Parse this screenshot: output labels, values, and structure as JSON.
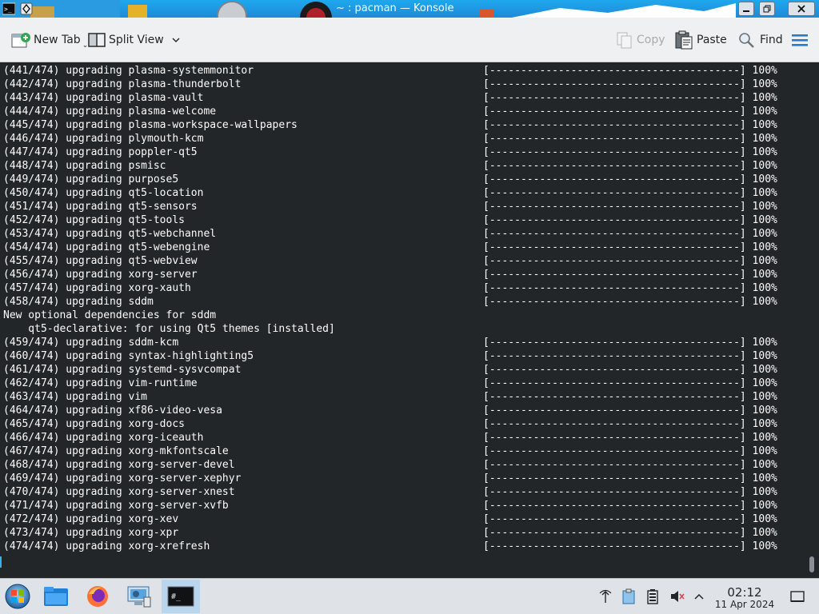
{
  "window": {
    "title": "~ : pacman — Konsole"
  },
  "toolbar": {
    "new_tab": "New Tab",
    "split_view": "Split View",
    "copy": "Copy",
    "paste": "Paste",
    "find": "Find"
  },
  "terminal": {
    "lines": [
      {
        "text": "(441/474) upgrading plasma-systemmonitor",
        "progress": "[----------------------------------------] 100%"
      },
      {
        "text": "(442/474) upgrading plasma-thunderbolt",
        "progress": "[----------------------------------------] 100%"
      },
      {
        "text": "(443/474) upgrading plasma-vault",
        "progress": "[----------------------------------------] 100%"
      },
      {
        "text": "(444/474) upgrading plasma-welcome",
        "progress": "[----------------------------------------] 100%"
      },
      {
        "text": "(445/474) upgrading plasma-workspace-wallpapers",
        "progress": "[----------------------------------------] 100%"
      },
      {
        "text": "(446/474) upgrading plymouth-kcm",
        "progress": "[----------------------------------------] 100%"
      },
      {
        "text": "(447/474) upgrading poppler-qt5",
        "progress": "[----------------------------------------] 100%"
      },
      {
        "text": "(448/474) upgrading psmisc",
        "progress": "[----------------------------------------] 100%"
      },
      {
        "text": "(449/474) upgrading purpose5",
        "progress": "[----------------------------------------] 100%"
      },
      {
        "text": "(450/474) upgrading qt5-location",
        "progress": "[----------------------------------------] 100%"
      },
      {
        "text": "(451/474) upgrading qt5-sensors",
        "progress": "[----------------------------------------] 100%"
      },
      {
        "text": "(452/474) upgrading qt5-tools",
        "progress": "[----------------------------------------] 100%"
      },
      {
        "text": "(453/474) upgrading qt5-webchannel",
        "progress": "[----------------------------------------] 100%"
      },
      {
        "text": "(454/474) upgrading qt5-webengine",
        "progress": "[----------------------------------------] 100%"
      },
      {
        "text": "(455/474) upgrading qt5-webview",
        "progress": "[----------------------------------------] 100%"
      },
      {
        "text": "(456/474) upgrading xorg-server",
        "progress": "[----------------------------------------] 100%"
      },
      {
        "text": "(457/474) upgrading xorg-xauth",
        "progress": "[----------------------------------------] 100%"
      },
      {
        "text": "(458/474) upgrading sddm",
        "progress": "[----------------------------------------] 100%"
      },
      {
        "text": "New optional dependencies for sddm",
        "progress": ""
      },
      {
        "text": "    qt5-declarative: for using Qt5 themes [installed]",
        "progress": ""
      },
      {
        "text": "(459/474) upgrading sddm-kcm",
        "progress": "[----------------------------------------] 100%"
      },
      {
        "text": "(460/474) upgrading syntax-highlighting5",
        "progress": "[----------------------------------------] 100%"
      },
      {
        "text": "(461/474) upgrading systemd-sysvcompat",
        "progress": "[----------------------------------------] 100%"
      },
      {
        "text": "(462/474) upgrading vim-runtime",
        "progress": "[----------------------------------------] 100%"
      },
      {
        "text": "(463/474) upgrading vim",
        "progress": "[----------------------------------------] 100%"
      },
      {
        "text": "(464/474) upgrading xf86-video-vesa",
        "progress": "[----------------------------------------] 100%"
      },
      {
        "text": "(465/474) upgrading xorg-docs",
        "progress": "[----------------------------------------] 100%"
      },
      {
        "text": "(466/474) upgrading xorg-iceauth",
        "progress": "[----------------------------------------] 100%"
      },
      {
        "text": "(467/474) upgrading xorg-mkfontscale",
        "progress": "[----------------------------------------] 100%"
      },
      {
        "text": "(468/474) upgrading xorg-server-devel",
        "progress": "[----------------------------------------] 100%"
      },
      {
        "text": "(469/474) upgrading xorg-server-xephyr",
        "progress": "[----------------------------------------] 100%"
      },
      {
        "text": "(470/474) upgrading xorg-server-xnest",
        "progress": "[----------------------------------------] 100%"
      },
      {
        "text": "(471/474) upgrading xorg-server-xvfb",
        "progress": "[----------------------------------------] 100%"
      },
      {
        "text": "(472/474) upgrading xorg-xev",
        "progress": "[----------------------------------------] 100%"
      },
      {
        "text": "(473/474) upgrading xorg-xpr",
        "progress": "[----------------------------------------] 100%"
      },
      {
        "text": "(474/474) upgrading xorg-xrefresh",
        "progress": "[----------------------------------------] 100%"
      }
    ]
  },
  "taskbar": {
    "apps": [
      {
        "icon": "start-orb-icon"
      },
      {
        "icon": "file-manager-icon"
      },
      {
        "icon": "firefox-icon"
      },
      {
        "icon": "system-settings-icon"
      },
      {
        "icon": "konsole-icon"
      }
    ],
    "tray_icons": [
      "network-icon",
      "clipboard-icon",
      "battery-icon",
      "volume-muted-icon",
      "chevron-up-icon"
    ],
    "clock": {
      "time": "02:12",
      "date": "11 Apr 2024"
    }
  },
  "colors": {
    "terminal_bg": "#232629",
    "terminal_fg": "#fcfcfc",
    "titlebar": "#1e8ad6",
    "accent": "#3daee9"
  }
}
